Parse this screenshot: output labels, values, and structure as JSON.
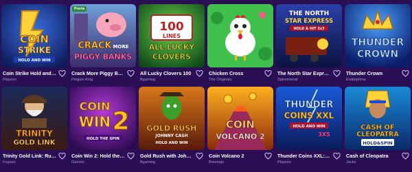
{
  "games": [
    {
      "title": "Coin Strike Hold and W...",
      "provider": "Playson",
      "art": [
        "COIN",
        "STRIKE",
        "HOLD AND WIN"
      ]
    },
    {
      "title": "Crack More Piggy Banks",
      "provider": "Pinguin King",
      "badge": "Previa",
      "art": [
        "CRACK",
        "MORE",
        "PIGGY BANKS"
      ]
    },
    {
      "title": "All Lucky Clovers 100",
      "provider": "Bgaming",
      "art": [
        "100",
        "LINES",
        "ALL LUCKY",
        "CLOVERS"
      ]
    },
    {
      "title": "Chicken Cross",
      "provider": "The Originals",
      "art": []
    },
    {
      "title": "The North Star Express ...",
      "provider": "Spinomenal",
      "art": [
        "THE NORTH",
        "STAR EXPRESS",
        "HOLD & HIT 3x3"
      ]
    },
    {
      "title": "Thunder Crown",
      "provider": "Endorphina",
      "art": [
        "THUNDER",
        "CROWN"
      ]
    },
    {
      "title": "Trinity Gold Link: Runni...",
      "provider": "Fugaso",
      "art": [
        "TRINITY",
        "GOLD LINK"
      ]
    },
    {
      "title": "Coin Win 2: Hold the Sp...",
      "provider": "Gamzix",
      "art": [
        "COIN",
        "WIN",
        "2",
        "HOLD THE SPIN"
      ]
    },
    {
      "title": "Gold Rush with Johnny...",
      "provider": "Bgaming",
      "art": [
        "GOLD RUSH",
        "JOHNNY CASH",
        "HOLD AND WIN"
      ]
    },
    {
      "title": "Coin Volcano 2",
      "provider": "Booongo",
      "art": [
        "COIN",
        "VOLCANO 2"
      ]
    },
    {
      "title": "Thunder Coins XXL: Hol...",
      "provider": "Playson",
      "art": [
        "THUNDER",
        "COINS XXL",
        "HOLD AND WIN",
        "3X5"
      ]
    },
    {
      "title": "Cash of Cleopatra",
      "provider": "Jacks",
      "art": [
        "CASH OF",
        "CLEOPATRA",
        "HOLD&SPIN"
      ]
    }
  ]
}
